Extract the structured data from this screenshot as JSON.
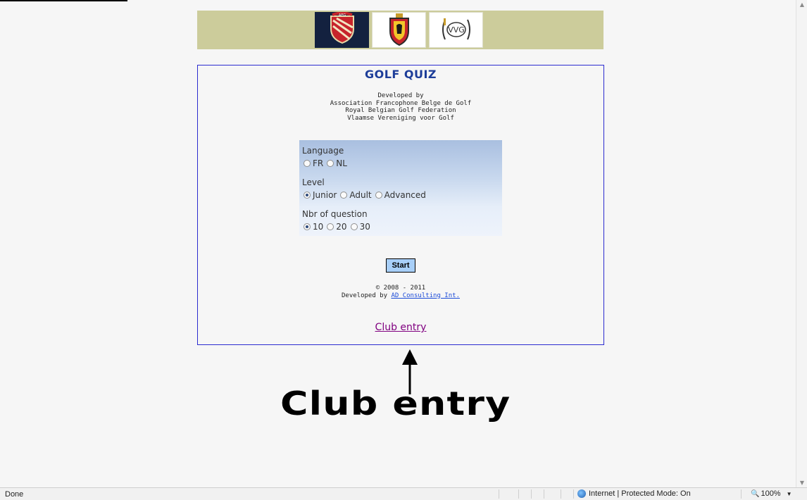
{
  "quiz": {
    "title": "GOLF QUIZ",
    "credits": [
      "Developed by",
      "Association Francophone Belge de Golf",
      "Royal Belgian Golf Federation",
      "Vlaamse Vereniging voor Golf"
    ],
    "language": {
      "label": "Language",
      "options": [
        "FR",
        "NL"
      ],
      "selected": null
    },
    "level": {
      "label": "Level",
      "options": [
        "Junior",
        "Adult",
        "Advanced"
      ],
      "selected": "Junior"
    },
    "questions": {
      "label": "Nbr of question",
      "options": [
        "10",
        "20",
        "30"
      ],
      "selected": "10"
    },
    "start_label": "Start",
    "copyright": "© 2008 - 2011",
    "developed_by_prefix": "Developed by ",
    "developed_by_link": "AD Consulting Int.",
    "club_entry_link": "Club entry"
  },
  "banner": {
    "logos": [
      {
        "name": "afg-logo",
        "text": "AFG"
      },
      {
        "name": "rbgf-logo"
      },
      {
        "name": "vvg-logo",
        "text": "VVG"
      }
    ]
  },
  "annotation": {
    "label": "Club entry"
  },
  "statusbar": {
    "status": "Done",
    "zone": "Internet | Protected Mode: On",
    "zoom": "100%"
  },
  "colors": {
    "banner_bg": "#cccc9b",
    "title": "#1d3d99",
    "frame_border": "#2b2bd0",
    "start_button": "#a8cff8",
    "visited_link": "#800080"
  }
}
